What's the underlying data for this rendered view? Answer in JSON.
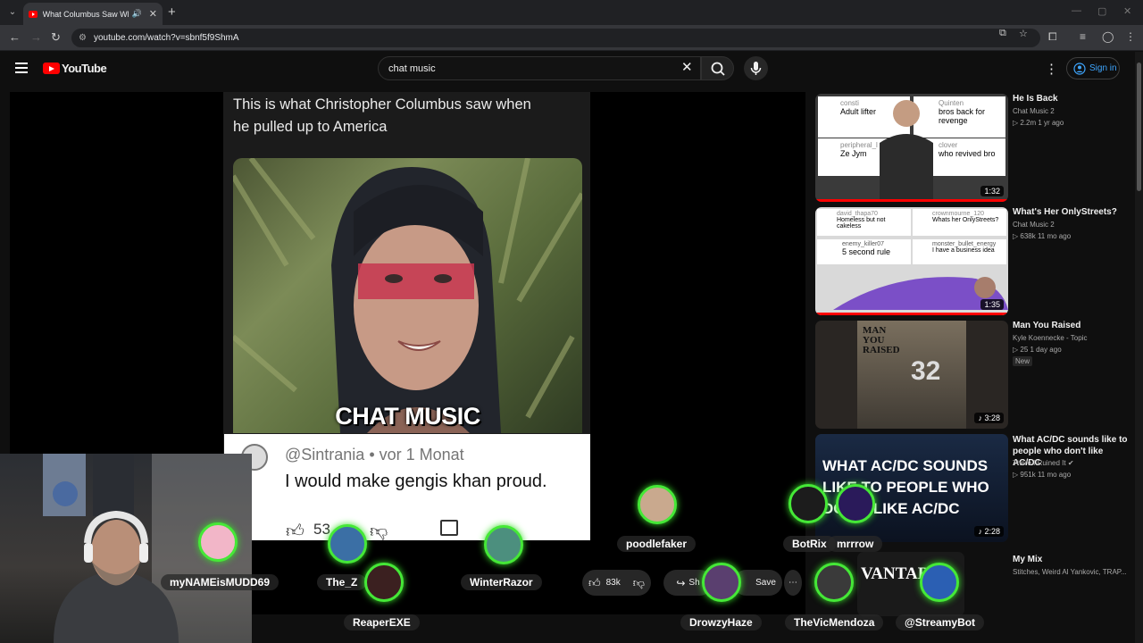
{
  "browser": {
    "tab_title": "What Columbus Saw When",
    "url": "youtube.com/watch?v=sbnf5f9ShmA"
  },
  "youtube": {
    "logo_text": "YouTube",
    "search_value": "chat music",
    "signin_label": "Sign in",
    "accent_color": "#ff0000",
    "link_color": "#3ea6ff"
  },
  "video": {
    "caption_line1": "This is what Christopher Columbus saw when",
    "caption_line2": "he pulled up to America",
    "overlay_label": "CHAT MUSIC",
    "comment_handle": "@Sintrania • vor 1 Monat",
    "comment_text": "I would make gengis khan proud.",
    "comment_likes": "53"
  },
  "actions": {
    "likes": "83k",
    "share_label": "Sh",
    "save_label": "Save"
  },
  "recommendations": [
    {
      "title": "He Is Back",
      "channel": "Chat Music 2",
      "meta": "▷ 2.2m  1 yr ago",
      "duration": "1:32",
      "mini": [
        {
          "user": "consti",
          "text": "Adult lifter"
        },
        {
          "user": "Quinten",
          "text": "bros back for revenge"
        },
        {
          "user": "peripheral_l",
          "text": "Ze Jym"
        },
        {
          "user": "clover",
          "text": "who revived bro"
        }
      ]
    },
    {
      "title": "What's Her OnlyStreets?",
      "channel": "Chat Music 2",
      "meta": "▷ 638k  11 mo ago",
      "duration": "1:35",
      "mini": [
        {
          "user": "david_thapa70",
          "text": "Homeless but not cakeless"
        },
        {
          "user": "crownmourne_120",
          "text": "Whats her OnlyStreets?"
        },
        {
          "user": "enemy_killer07",
          "text": "5 second rule"
        },
        {
          "user": "monster_bullet_energy",
          "text": "I have a business idea"
        }
      ]
    },
    {
      "title": "Man You Raised",
      "channel": "Kyle Koennecke - Topic",
      "meta": "▷ 25  1 day ago",
      "duration": "3:28",
      "badge": "New",
      "thumb_text": "MAN YOU RAISED"
    },
    {
      "title": "What AC/DC sounds like to people who don't like AC/DC",
      "channel": "There I Ruined It",
      "meta": "▷ 951k  11 mo ago",
      "duration": "2:28",
      "thumb_text": "WHAT AC/DC SOUNDS LIKE TO PEOPLE WHO DON'T LIKE AC/DC"
    },
    {
      "title": "My Mix",
      "channel": "Stitches, Weird Al Yankovic, TRAP...",
      "thumb_text": "VANTABL"
    }
  ],
  "chat_users": [
    "myNAMEisMUDD69",
    "The_Z",
    "ReaperEXE",
    "WinterRazor",
    "poodlefaker",
    "DrowzyHaze",
    "BotRix",
    "mrrrow",
    "TheVicMendoza",
    "@StreamyBot"
  ]
}
